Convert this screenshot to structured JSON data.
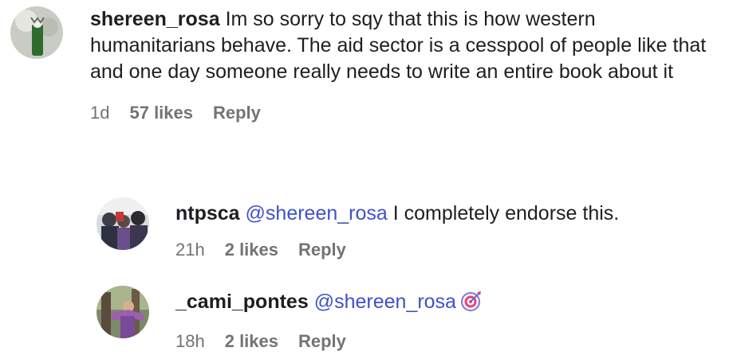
{
  "comments": [
    {
      "username": "shereen_rosa",
      "text": "Im so sorry to sqy that this is how western humanitarians behave. The aid sector is a cesspool of people like that and one day someone really needs to write an entire book about it",
      "time": "1d",
      "likes": "57 likes",
      "reply_label": "Reply"
    },
    {
      "username": "ntpsca",
      "mention": "@shereen_rosa",
      "text": "I completely endorse this.",
      "time": "21h",
      "likes": "2 likes",
      "reply_label": "Reply"
    },
    {
      "username": "_cami_pontes",
      "mention": "@shereen_rosa",
      "emoji": "direct-hit-target-icon",
      "time": "18h",
      "likes": "2 likes",
      "reply_label": "Reply"
    }
  ],
  "colors": {
    "mention": "#3f51c9",
    "meta": "#737373",
    "text": "#1c1e21"
  }
}
